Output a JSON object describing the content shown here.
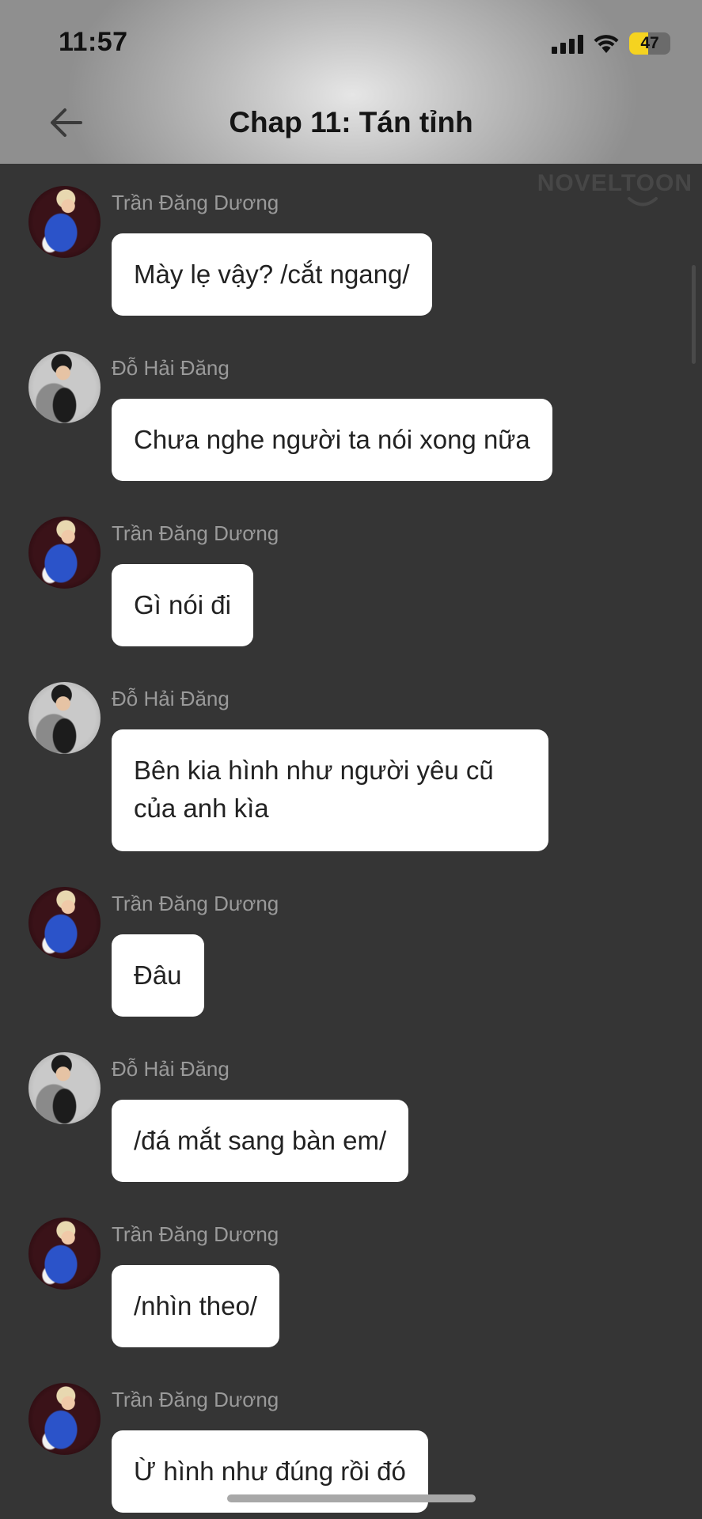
{
  "status_bar": {
    "time": "11:57",
    "battery": "47",
    "battery_level": 0.47
  },
  "header": {
    "title": "Chap 11: Tán tỉnh"
  },
  "watermark": "NOVELTOON",
  "messages": [
    {
      "speaker": "Trần Đăng Dương",
      "text": "Mày lẹ vậy? /cắt ngang/"
    },
    {
      "speaker": "Đỗ Hải Đăng",
      "text": "Chưa nghe người ta nói xong nữa"
    },
    {
      "speaker": "Trần Đăng Dương",
      "text": "Gì nói đi"
    },
    {
      "speaker": "Đỗ Hải Đăng",
      "text": "Bên kia hình như người yêu cũ của anh kìa"
    },
    {
      "speaker": "Trần Đăng Dương",
      "text": "Đâu"
    },
    {
      "speaker": "Đỗ Hải Đăng",
      "text": "/đá mắt sang bàn em/"
    },
    {
      "speaker": "Trần Đăng Dương",
      "text": "/nhìn theo/"
    },
    {
      "speaker": "Trần Đăng Dương",
      "text": "Ừ hình như đúng rồi đó"
    }
  ]
}
